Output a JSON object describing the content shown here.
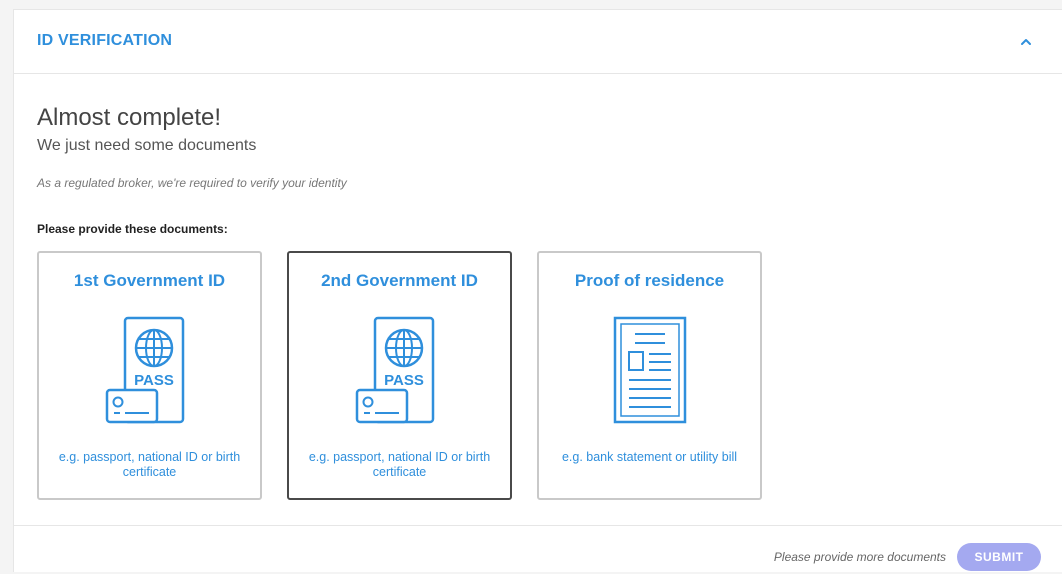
{
  "section": {
    "title": "ID VERIFICATION",
    "collapse_icon": "chevron-up-icon",
    "accent_color": "#2f8fdc"
  },
  "intro": {
    "heading": "Almost complete!",
    "subheading": "We just need some documents",
    "note": "As a regulated broker, we're required to verify your identity"
  },
  "documents": {
    "prompt": "Please provide these documents:",
    "cards": [
      {
        "title": "1st Government ID",
        "hint": "e.g. passport, national ID or birth certificate",
        "icon": "passport-id-icon",
        "selected": false
      },
      {
        "title": "2nd Government ID",
        "hint": "e.g. passport, national ID or birth certificate",
        "icon": "passport-id-icon",
        "selected": true
      },
      {
        "title": "Proof of residence",
        "hint": "e.g. bank statement or utility bill",
        "icon": "document-icon",
        "selected": false
      }
    ]
  },
  "footer": {
    "note": "Please provide more documents",
    "submit_label": "SUBMIT",
    "submit_color": "#a4a9f0"
  }
}
